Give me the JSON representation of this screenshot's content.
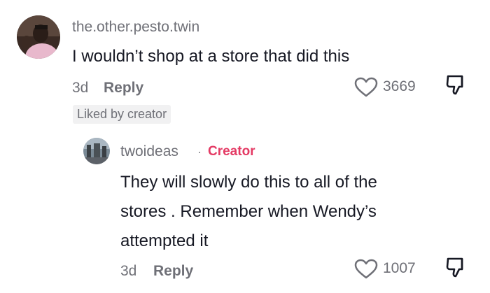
{
  "comment": {
    "username": "the.other.pesto.twin",
    "text": "I wouldn’t shop at a store that did this",
    "time": "3d",
    "reply_label": "Reply",
    "like_count": "3669",
    "liked_badge": "Liked by creator"
  },
  "reply": {
    "username": "twoideas",
    "separator": "·",
    "creator_label": "Creator",
    "text_lines": [
      "They will slowly do this to all of the",
      "stores . Remember when Wendy’s",
      "attempted it"
    ],
    "time": "3d",
    "reply_label": "Reply",
    "like_count": "1007"
  },
  "icons": {
    "like": "heart-icon",
    "dislike": "thumbs-down-icon"
  },
  "colors": {
    "username": "#6f7077",
    "text": "#161823",
    "creator": "#e43a64",
    "badge_bg": "#f1f1f2"
  }
}
